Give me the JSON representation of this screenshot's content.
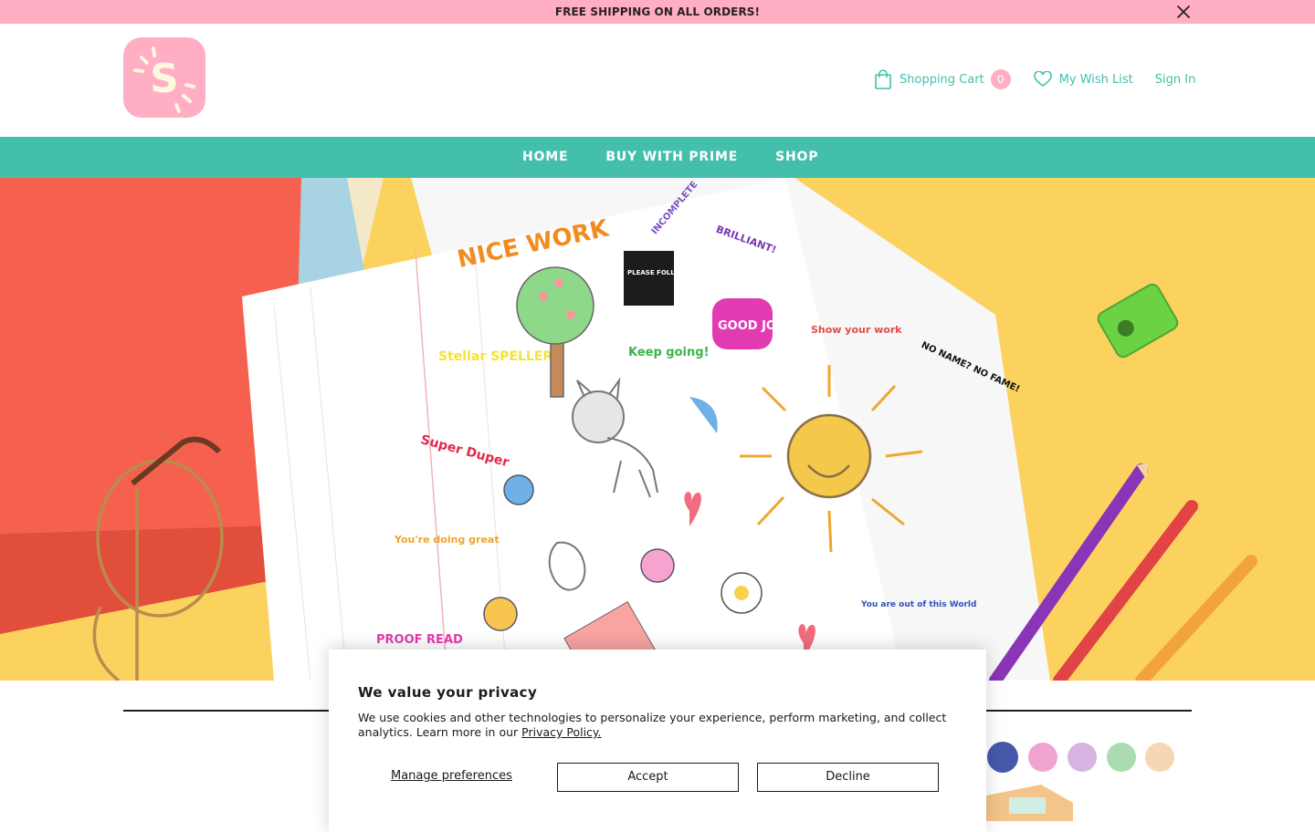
{
  "announcement": {
    "text": "FREE SHIPPING ON ALL ORDERS!",
    "close_icon": "close-icon"
  },
  "header": {
    "logo_letter": "S",
    "cart": {
      "label": "Shopping Cart",
      "count": "0",
      "icon": "shopping-bag-icon"
    },
    "wishlist": {
      "label": "My Wish List",
      "icon": "heart-icon"
    },
    "signin": {
      "label": "Sign In"
    }
  },
  "nav": {
    "items": [
      {
        "label": "HOME"
      },
      {
        "label": "BUY WITH PRIME"
      },
      {
        "label": "SHOP"
      }
    ]
  },
  "hero": {
    "stamps": [
      "NICE WORK",
      "INCOMPLETE",
      "BRILLIANT!",
      "PLEASE FOLLOW DIRECTIONS",
      "Stellar SPELLER",
      "Keep going!",
      "GOOD JOB!",
      "Show your work",
      "NO NAME? NO FAME!",
      "Super Duper",
      "You're doing great",
      "You are out of this World",
      "PROOF READ"
    ]
  },
  "cookie": {
    "title": "We value your privacy",
    "body": "We use cookies and other technologies to personalize your experience, perform marketing, and collect analytics. Learn more in our ",
    "policy_link": "Privacy Policy.",
    "manage": "Manage preferences",
    "accept": "Accept",
    "decline": "Decline"
  },
  "colors": {
    "pink": "#ffaec4",
    "teal": "#43bfac",
    "yellow": "#fbd25e"
  }
}
